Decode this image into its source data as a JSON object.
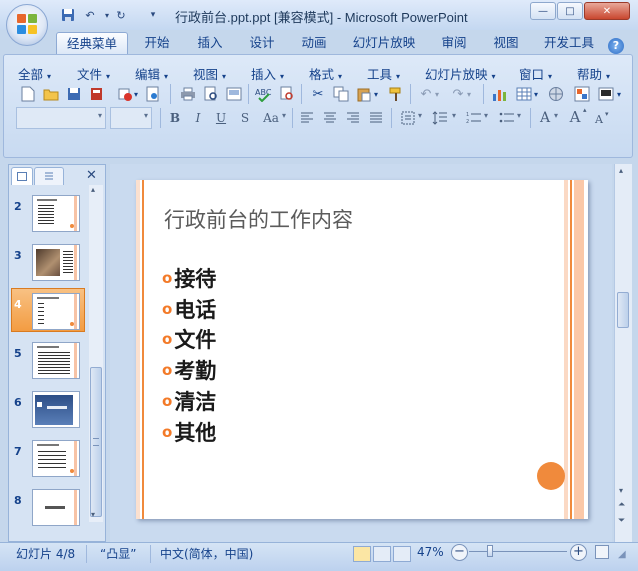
{
  "window": {
    "title": "行政前台.ppt.ppt [兼容模式] - Microsoft PowerPoint",
    "quick_access": [
      "save-icon",
      "undo-icon",
      "redo-icon",
      "customize-icon"
    ],
    "controls": {
      "minimize": "—",
      "maximize": "□",
      "close": "✕"
    }
  },
  "tabs": [
    "经典菜单",
    "开始",
    "插入",
    "设计",
    "动画",
    "幻灯片放映",
    "审阅",
    "视图",
    "开发工具"
  ],
  "active_tab": "经典菜单",
  "menus": [
    "全部",
    "文件",
    "编辑",
    "视图",
    "插入",
    "格式",
    "工具",
    "幻灯片放映",
    "窗口",
    "帮助"
  ],
  "format_buttons": [
    "B",
    "I",
    "U",
    "S",
    "Aa"
  ],
  "font_size_buttons": [
    "A",
    "A",
    "A"
  ],
  "slides_panel": {
    "close_label": "✕",
    "slide_numbers": [
      "2",
      "3",
      "4",
      "5",
      "6",
      "7",
      "8"
    ],
    "selected": "4"
  },
  "slide": {
    "title": "行政前台的工作内容",
    "bullet_marker": "o",
    "bullets": [
      "接待",
      "电话",
      "文件",
      "考勤",
      "清洁",
      "其他"
    ],
    "accent_color": "#f08a3c"
  },
  "status": {
    "slide_position": "幻灯片 4/8",
    "theme": "“凸显”",
    "language": "中文(简体，中国)",
    "zoom": "47%",
    "zoom_out": "−",
    "zoom_in": "+"
  },
  "colors": {
    "ribbon_bg": "#c8daf1",
    "accent_orange": "#f08a3c",
    "selected_slide": "#f39c42"
  }
}
